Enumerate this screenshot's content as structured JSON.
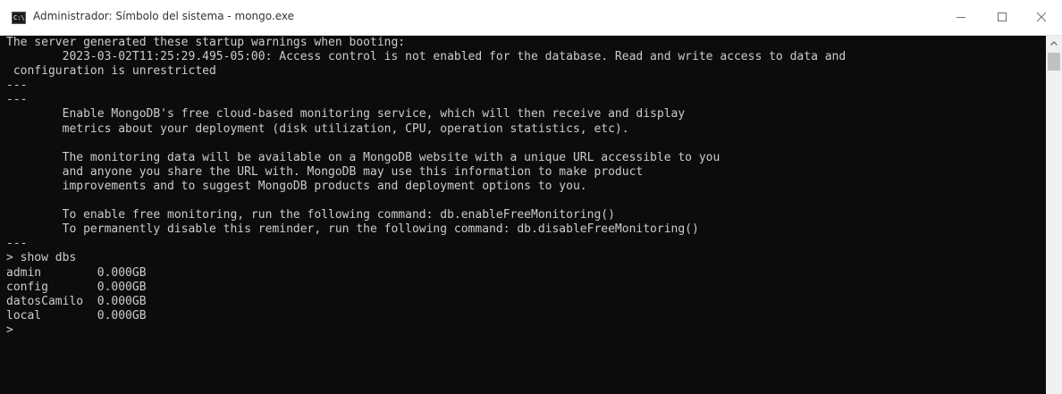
{
  "window": {
    "title": "Administrador: Símbolo del sistema - mongo.exe",
    "app_icon_text": "C:\\",
    "icons": {
      "app": "command-prompt-icon",
      "minimize": "minimize-icon",
      "maximize": "maximize-icon",
      "close": "close-icon",
      "scroll_up": "chevron-up-icon"
    }
  },
  "console": {
    "colors": {
      "background": "#0c0c0c",
      "text": "#cccccc"
    },
    "lines": [
      "The server generated these startup warnings when booting:",
      "        2023-03-02T11:25:29.495-05:00: Access control is not enabled for the database. Read and write access to data and",
      " configuration is unrestricted",
      "---",
      "---",
      "        Enable MongoDB's free cloud-based monitoring service, which will then receive and display",
      "        metrics about your deployment (disk utilization, CPU, operation statistics, etc).",
      "",
      "        The monitoring data will be available on a MongoDB website with a unique URL accessible to you",
      "        and anyone you share the URL with. MongoDB may use this information to make product",
      "        improvements and to suggest MongoDB products and deployment options to you.",
      "",
      "        To enable free monitoring, run the following command: db.enableFreeMonitoring()",
      "        To permanently disable this reminder, run the following command: db.disableFreeMonitoring()",
      "---",
      "> show dbs",
      "admin        0.000GB",
      "config       0.000GB",
      "datosCamilo  0.000GB",
      "local        0.000GB",
      ">"
    ]
  }
}
